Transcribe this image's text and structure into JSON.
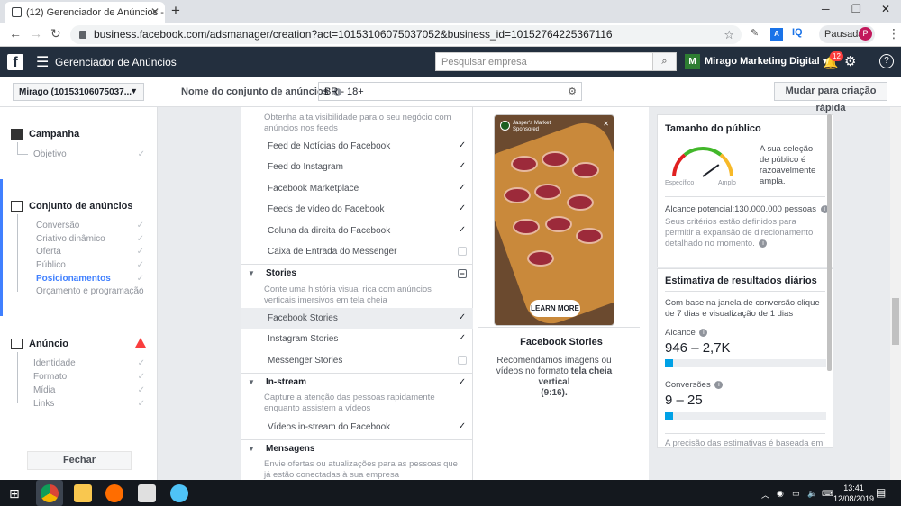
{
  "browser": {
    "tab_title": "(12) Gerenciador de Anúncios - C",
    "url": "business.facebook.com/adsmanager/creation?act=10153106075037052&business_id=10152764225367116",
    "profile_label": "Pausada",
    "profile_initial": "P",
    "ext_iq": "IQ"
  },
  "fb": {
    "app_title": "Gerenciador de Anúncios",
    "search_placeholder": "Pesquisar empresa",
    "account_name": "Mirago Marketing Digital",
    "notif_count": "12"
  },
  "subbar": {
    "account_select": "Mirago (10153106075037...",
    "adset_label": "Nome do conjunto de anúncios",
    "adset_value": "BR - 18+",
    "quick_button": "Mudar para criação rápida"
  },
  "sidebar": {
    "campaign": {
      "title": "Campanha",
      "items": [
        "Objetivo"
      ]
    },
    "adset": {
      "title": "Conjunto de anúncios",
      "items": [
        "Conversão",
        "Criativo dinâmico",
        "Oferta",
        "Público",
        "Posicionamentos",
        "Orçamento e programação"
      ]
    },
    "ad": {
      "title": "Anúncio",
      "items": [
        "Identidade",
        "Formato",
        "Mídia",
        "Links"
      ]
    },
    "close": "Fechar"
  },
  "placements": {
    "feeds_desc": "Obtenha alta visibilidade para o seu negócio com anúncios nos feeds",
    "feeds": [
      "Feed de Notícias do Facebook",
      "Feed do Instagram",
      "Facebook Marketplace",
      "Feeds de vídeo do Facebook",
      "Coluna da direita do Facebook",
      "Caixa de Entrada do Messenger"
    ],
    "stories_title": "Stories",
    "stories_desc": "Conte uma história visual rica com anúncios verticais imersivos em tela cheia",
    "stories": [
      "Facebook Stories",
      "Instagram Stories",
      "Messenger Stories"
    ],
    "instream_title": "In-stream",
    "instream_desc": "Capture a atenção das pessoas rapidamente enquanto assistem a vídeos",
    "instream": [
      "Vídeos in-stream do Facebook"
    ],
    "messages_title": "Mensagens",
    "messages_desc": "Envie ofertas ou atualizações para as pessoas que já estão conectadas à sua empresa"
  },
  "preview": {
    "page_name": "Jasper's Market",
    "sponsored": "Sponsored",
    "cta": "LEARN MORE",
    "title": "Facebook Stories",
    "desc_1": "Recomendamos imagens ou vídeos no formato ",
    "desc_bold": "tela cheia vertical",
    "desc_2": "(9:16)."
  },
  "audience": {
    "title": "Tamanho do público",
    "gauge_left": "Específico",
    "gauge_right": "Amplo",
    "gauge_level": 0.8,
    "summary": "A sua seleção de público é razoavelmente ampla.",
    "reach_label": "Alcance potencial:",
    "reach_value": "130.000.000 pessoas",
    "note": "Seus critérios estão definidos para permitir a expansão de direcionamento detalhado no momento."
  },
  "estimates": {
    "title": "Estimativa de resultados diários",
    "intro": "Com base na janela de conversão clique de 7 dias e visualização de 1 dias",
    "reach_label": "Alcance",
    "reach_value": "946 – 2,7K",
    "reach_fill": 0.05,
    "conv_label": "Conversões",
    "conv_value": "9 – 25",
    "conv_fill": 0.05,
    "footer": "A precisão das estimativas é baseada em"
  },
  "taskbar": {
    "time": "13:41",
    "date": "12/08/2019"
  },
  "colors": {
    "accent": "#4080ff",
    "fb_bar": "#232f3e",
    "warn": "#fa3e3e"
  }
}
